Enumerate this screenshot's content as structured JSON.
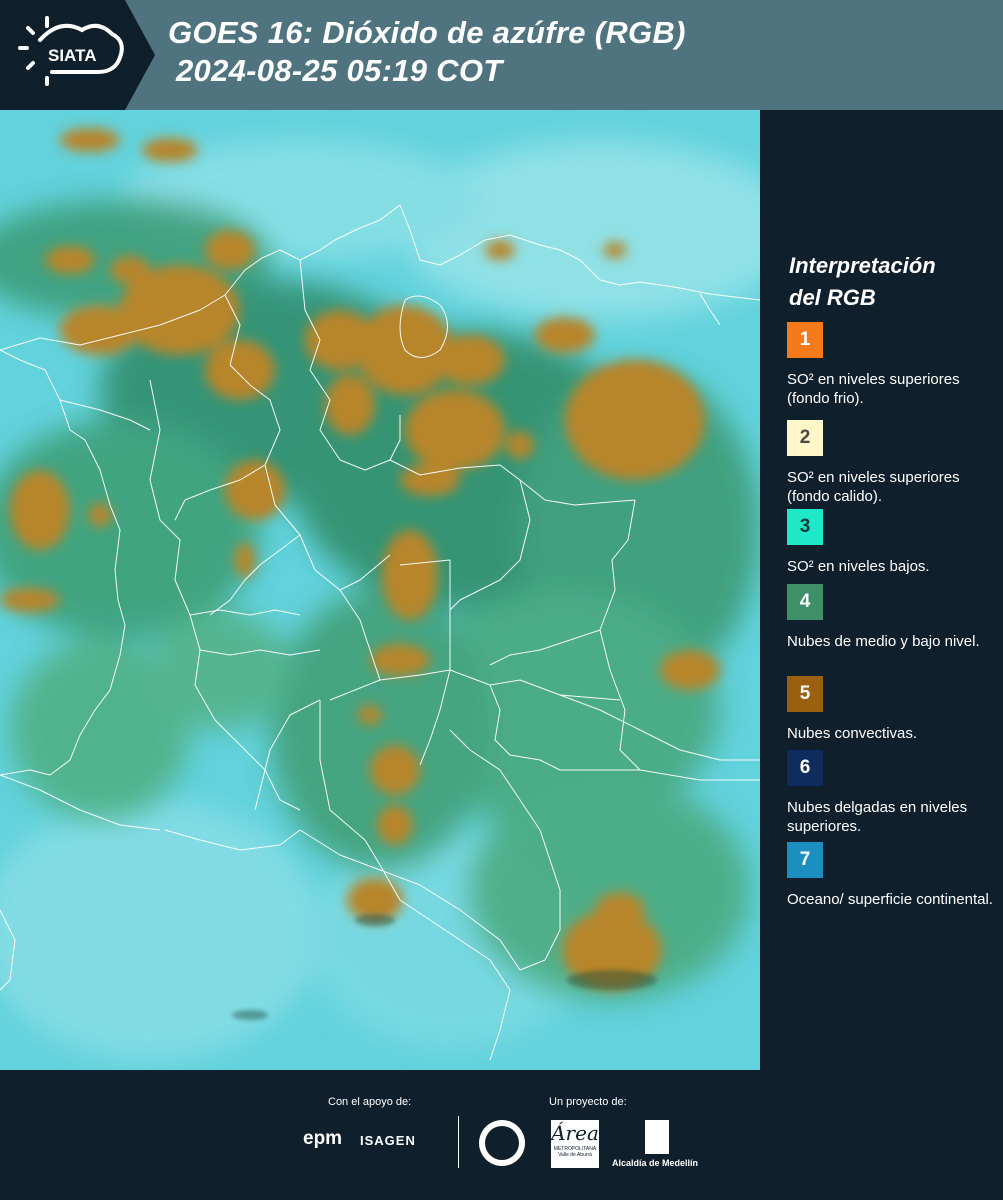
{
  "header": {
    "logo_text": "SIATA",
    "title_line1": "GOES 16: Dióxido de azúfre (RGB)",
    "title_line2": "2024-08-25 05:19 COT",
    "background_color": "#4f7480"
  },
  "map": {
    "description_icon": "satellite-map-image"
  },
  "legend": {
    "title_line1": "Interpretación",
    "title_line2": "del RGB",
    "items": [
      {
        "number": "1",
        "color": "#f47a1c",
        "text_color": "#ffffff",
        "label": "SO² en niveles superiores (fondo frio)."
      },
      {
        "number": "2",
        "color": "#fff7c8",
        "text_color": "#4a4a4a",
        "label": "SO² en niveles superiores (fondo calido)."
      },
      {
        "number": "3",
        "color": "#1ee8c8",
        "text_color": "#0f3a3a",
        "label": "SO² en niveles bajos."
      },
      {
        "number": "4",
        "color": "#3f8f68",
        "text_color": "#ffffff",
        "label": "Nubes de medio y bajo nivel."
      },
      {
        "number": "5",
        "color": "#9a6010",
        "text_color": "#ffffff",
        "label": "Nubes convectivas."
      },
      {
        "number": "6",
        "color": "#0e2d5e",
        "text_color": "#ffffff",
        "label": "Nubes delgadas en niveles superiores."
      },
      {
        "number": "7",
        "color": "#1b8fc0",
        "text_color": "#ffffff",
        "label": "Oceano/ superficie continental."
      }
    ]
  },
  "footer": {
    "support_label": "Con el apoyo de:",
    "project_label": "Un proyecto de:",
    "epm": "epm",
    "isagen": "ISAGEN",
    "area_big": "Área",
    "area_small": "METROPOLITANA Valle de Aburrá",
    "alcaldia": "Alcaldía de Medellín"
  }
}
